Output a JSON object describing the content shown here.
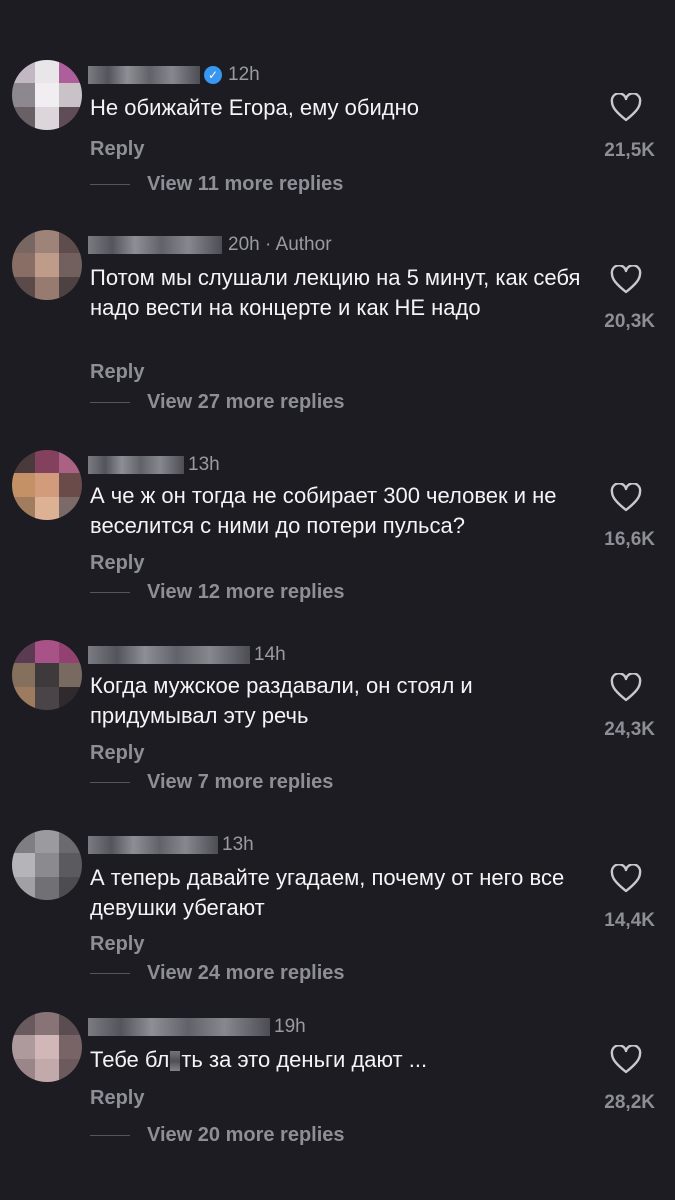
{
  "comments": [
    {
      "time": "12h",
      "author_tag": "",
      "verified": true,
      "text": "Не обижайте Егора, ему обидно",
      "reply_label": "Reply",
      "view_more": "View 11 more replies",
      "likes": "21,5K",
      "avatar_colors": [
        "#c3b8c4",
        "#e9e6ea",
        "#b45c9e",
        "#8d8890",
        "#f0eef0",
        "#c9c3c8",
        "#6a6066",
        "#dcd6da",
        "#5f4c58"
      ]
    },
    {
      "time": "20h",
      "author_tag": "· Author",
      "verified": false,
      "text": "Потом мы слушали лекцию на 5 минут, как себя надо вести на концерте и как НЕ надо",
      "reply_label": "Reply",
      "view_more": "View 27 more replies",
      "likes": "20,3K",
      "avatar_colors": [
        "#7a6662",
        "#a08376",
        "#5f4d4c",
        "#8c6d64",
        "#c29a87",
        "#72605c",
        "#5b4b4a",
        "#9b7a6e",
        "#4e4141"
      ]
    },
    {
      "time": "13h",
      "author_tag": "",
      "verified": false,
      "text": "А че ж он тогда не собирает 300 человек и не веселится с ними до потери пульса?",
      "reply_label": "Reply",
      "view_more": "View 12 more replies",
      "likes": "16,6K",
      "avatar_colors": [
        "#4b3a3c",
        "#8a3f5e",
        "#b05f85",
        "#c99060",
        "#d79a78",
        "#6e4a48",
        "#a67b5a",
        "#e0b090",
        "#7d6a66"
      ]
    },
    {
      "time": "14h",
      "author_tag": "",
      "verified": false,
      "text": "Когда мужское раздавали, он стоял и придумывал эту речь",
      "reply_label": "Reply",
      "view_more": "View 7 more replies",
      "likes": "24,3K",
      "avatar_colors": [
        "#5e3a55",
        "#b0508a",
        "#9a3f73",
        "#86705a",
        "#3e3a3c",
        "#7a6a60",
        "#a07a5a",
        "#4b4448",
        "#2e2a2e"
      ]
    },
    {
      "time": "13h",
      "author_tag": "",
      "verified": false,
      "text": "А теперь давайте угадаем, почему от него все девушки убегают",
      "reply_label": "Reply",
      "view_more": "View 24 more replies",
      "likes": "14,4K",
      "avatar_colors": [
        "#7e7e84",
        "#9a9aa0",
        "#6a6a70",
        "#b4b4ba",
        "#8a8a90",
        "#5a5a60",
        "#a0a0a6",
        "#707076",
        "#4c4c52"
      ]
    },
    {
      "time": "19h",
      "author_tag": "",
      "verified": false,
      "text": "Тебе бл",
      "text_tail": "ть за это деньги дают ...",
      "reply_label": "Reply",
      "view_more": "View 20 more replies",
      "likes": "28,2K",
      "avatar_colors": [
        "#6a5a5e",
        "#8a7276",
        "#5b4c50",
        "#b09a9c",
        "#d4b6b8",
        "#7a6266",
        "#9c8488",
        "#c4a8aa",
        "#6e5a5e"
      ]
    }
  ],
  "colors": {
    "background": "#1c1c22",
    "text": "#f4f4f6",
    "muted": "#8e8e96",
    "verified": "#3897f0"
  },
  "icons": {
    "like": "heart-outline-icon",
    "verified": "verified-badge-icon"
  }
}
